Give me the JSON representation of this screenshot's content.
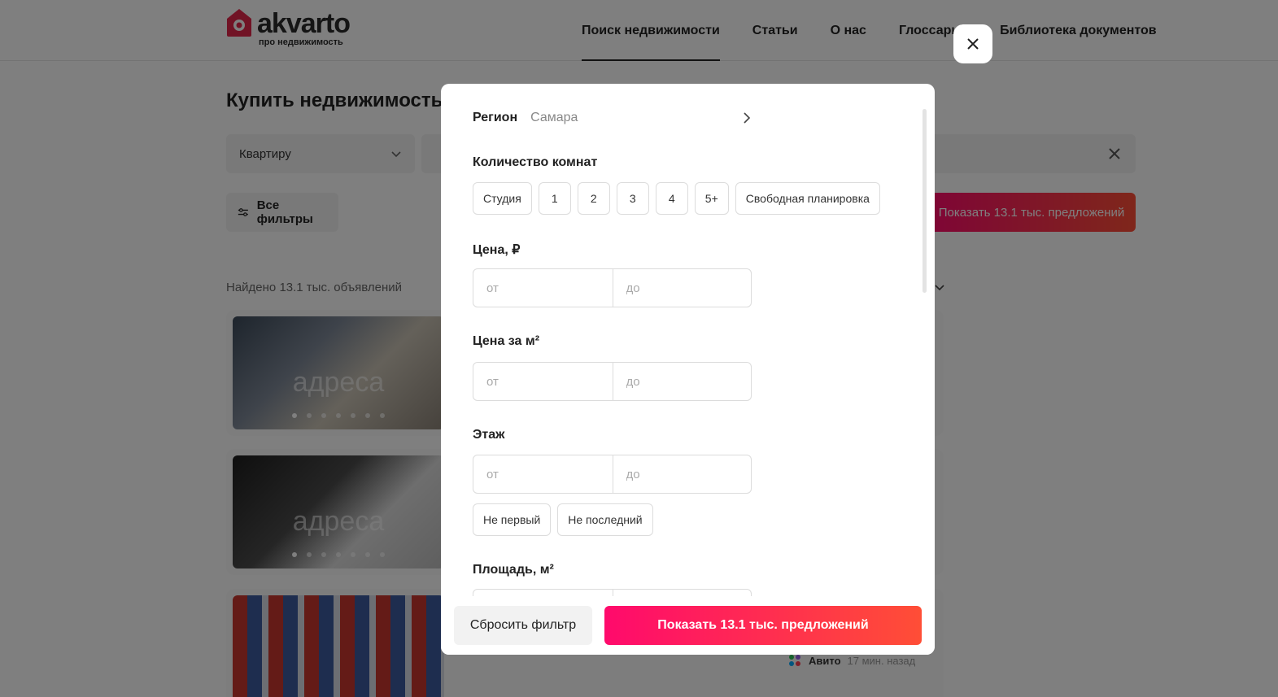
{
  "header": {
    "logo_text": "akvarto",
    "logo_subtitle": "про недвижимость",
    "nav": [
      {
        "label": "Поиск недвижимости"
      },
      {
        "label": "Статьи"
      },
      {
        "label": "О нас"
      },
      {
        "label": "Глоссарий"
      },
      {
        "label": "Библиотека документов"
      }
    ]
  },
  "page": {
    "title": "Купить недвижимость",
    "property_type": "Квартиру",
    "all_filters_label": "Все фильтры",
    "show_button_label": "Показать 13.1 тыс. предложений",
    "found_text": "Найдено 13.1 тыс. объявлений",
    "watermark": "адреса",
    "source_name": "Авито",
    "source_time": "17 мин. назад"
  },
  "modal": {
    "region": {
      "label": "Регион",
      "value": "Самара"
    },
    "rooms": {
      "title": "Количество комнат",
      "options": [
        "Студия",
        "1",
        "2",
        "3",
        "4",
        "5+",
        "Свободная планировка"
      ]
    },
    "price": {
      "title": "Цена, ₽",
      "from_placeholder": "от",
      "to_placeholder": "до"
    },
    "price_per_m2": {
      "title": "Цена за м²",
      "from_placeholder": "от",
      "to_placeholder": "до"
    },
    "floor": {
      "title": "Этаж",
      "from_placeholder": "от",
      "to_placeholder": "до",
      "options": [
        "Не первый",
        "Не последний"
      ]
    },
    "area": {
      "title": "Площадь, м²"
    },
    "reset_label": "Сбросить фильтр",
    "show_label": "Показать 13.1 тыс. предложений"
  },
  "colors": {
    "accent_start": "#ff0a6c",
    "accent_end": "#ff4e36",
    "logo_red": "#e3264a"
  }
}
